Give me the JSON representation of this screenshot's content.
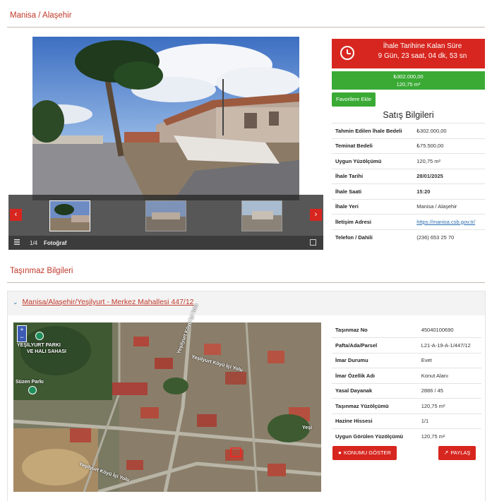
{
  "page": {
    "location_title": "Manisa / Alaşehir",
    "property_section_title": "Taşınmaz Bilgileri"
  },
  "gallery": {
    "counter": "1/4",
    "photo_label": "Fotoğraf",
    "prev_icon": "chevron-left-icon",
    "next_icon": "chevron-right-icon"
  },
  "timer": {
    "title": "İhale Tarihine Kalan Süre",
    "remaining": "9 Gün, 23 saat, 04 dk, 53 sn"
  },
  "price": {
    "amount": "₺302.000,00",
    "area": "120,75 m²"
  },
  "favorite_button": "Favorilere Ekle",
  "sales_info": {
    "title": "Satış Bilgileri",
    "rows": [
      {
        "label": "Tahmin Edilen İhale Bedeli",
        "value": "₺302.000,00"
      },
      {
        "label": "Teminat Bedeli",
        "value": "₺75.500,00"
      },
      {
        "label": "Uygun Yüzölçümü",
        "value": "120,75 m²"
      },
      {
        "label": "İhale Tarihi",
        "value": "28/01/2025"
      },
      {
        "label": "İhale Saati",
        "value": "15:20"
      },
      {
        "label": "İhale Yeri",
        "value": "Manisa / Alaşehir"
      },
      {
        "label": "İletişim Adresi",
        "value": "https://manisa.csb.gov.tr/"
      },
      {
        "label": "Telefon / Dahili",
        "value": "(236) 653 25 70"
      }
    ]
  },
  "property": {
    "header": "Manisa/Alaşehir/Yeşilyurt - Merkez Mahallesi 447/12",
    "rows": [
      {
        "label": "Taşınmaz No",
        "value": "45040100690"
      },
      {
        "label": "Pafta/Ada/Parsel",
        "value": "L21-A-19-A-1/447/12"
      },
      {
        "label": "İmar Durumu",
        "value": "Evet"
      },
      {
        "label": "İmar Özellik Adı",
        "value": "Konut Alanı"
      },
      {
        "label": "Yasal Dayanak",
        "value": "2886 / 45"
      },
      {
        "label": "Taşınmaz Yüzölçümü",
        "value": "120,75 m²"
      },
      {
        "label": "Hazine Hissesi",
        "value": "1/1"
      },
      {
        "label": "Uygun Görülen Yüzölçümü",
        "value": "120,75 m²"
      }
    ],
    "location_button": "KONUMU GÖSTER",
    "share_button": "PAYLAŞ"
  },
  "map": {
    "labels": {
      "park1": "YEŞİLYURT PARKI",
      "park1b": "VE HALI SAHASI",
      "park2": "Süzen Parkı",
      "street1": "Yeşilyurt Köyü İçi Yolu",
      "street2": "Yeşilyurt Köyü İçi Yolu",
      "street3": "Yeşilyurt Köyü İçi Yolu",
      "right_label": "Yeşi"
    }
  },
  "colors": {
    "accent_red": "#d7261f",
    "accent_green": "#3aaa35",
    "link_blue": "#2a6db0"
  }
}
